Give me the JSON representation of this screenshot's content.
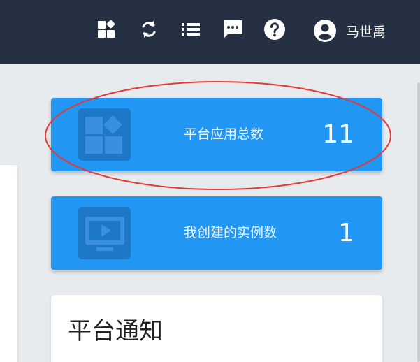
{
  "header": {
    "icons": [
      "apps-icon",
      "refresh-icon",
      "list-icon",
      "message-icon",
      "help-icon"
    ],
    "user_name": "马世禹",
    "background": "#253142"
  },
  "stats": [
    {
      "icon": "apps-icon",
      "label": "平台应用总数",
      "value": "11"
    },
    {
      "icon": "monitor-play-icon",
      "label": "我创建的实例数",
      "value": "1"
    }
  ],
  "notice": {
    "title": "平台通知"
  },
  "colors": {
    "card_blue": "#2196f3",
    "icon_tile": "#1e78c8",
    "annotation_red": "#e53935",
    "page_background": "#e8ebee"
  }
}
